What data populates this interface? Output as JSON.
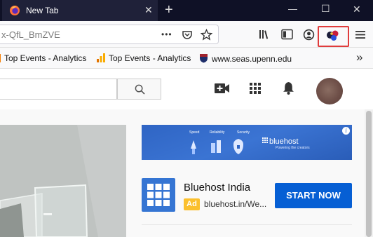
{
  "browser": {
    "tab_title": "New Tab",
    "tab_close": "✕",
    "new_tab": "+",
    "url_text": "x-QfL_BmZVE",
    "page_actions": "•••",
    "overflow": "»",
    "window": {
      "minimize": "—",
      "maximize": "☐",
      "close": "✕"
    }
  },
  "bookmarks": [
    {
      "label": "Top Events - Analytics"
    },
    {
      "label": "Top Events - Analytics"
    },
    {
      "label": "www.seas.upenn.edu"
    }
  ],
  "ad": {
    "name": "Bluehost India",
    "badge": "Ad",
    "url": "bluehost.in/We...",
    "cta": "START NOW",
    "banner_brand": "bluehost",
    "banner_tagline": "Powering the creators",
    "banner_labels": [
      "Speed",
      "Reliability",
      "Security"
    ],
    "info": "i"
  },
  "colors": {
    "tabbar": "#0f1126",
    "highlight": "#e03c3c",
    "cta": "#065fd4",
    "ad_badge": "#fbc02d",
    "bluehost": "#3575d3"
  }
}
